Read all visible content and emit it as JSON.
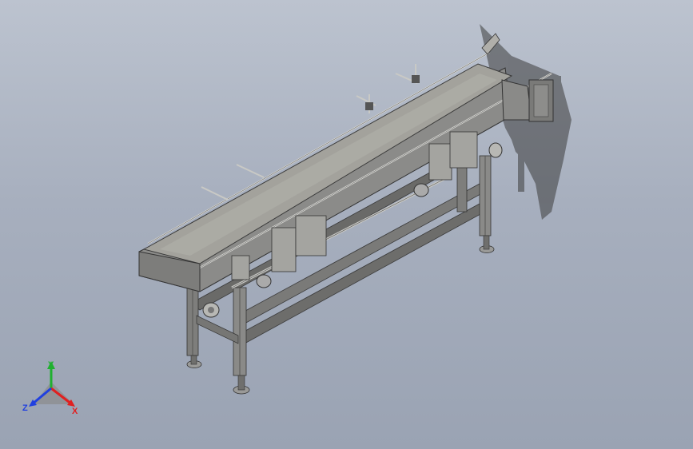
{
  "viewport": {
    "background_top": "#bcc3cf",
    "background_bottom": "#9aa3b3",
    "model": "belt-conveyor-assembly",
    "colors": {
      "frame": "#8e8e8c",
      "frame_dark": "#5f5f5d",
      "belt": "#9d9c97",
      "belt_light": "#b4b3ad",
      "shadow": "#3a3a3a"
    }
  },
  "triad": {
    "x_label": "X",
    "y_label": "Y",
    "z_label": "Z",
    "x_color": "#e02020",
    "y_color": "#20b030",
    "z_color": "#2040e0"
  }
}
